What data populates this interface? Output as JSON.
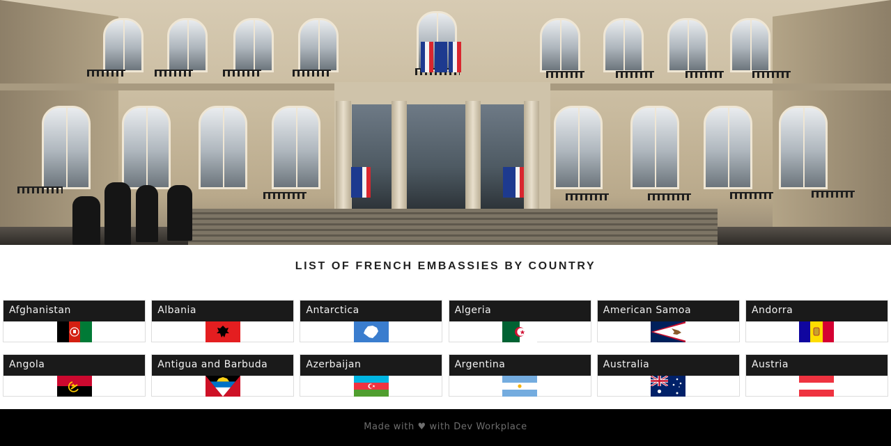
{
  "page": {
    "title": "LIST OF FRENCH EMBASSIES BY COUNTRY"
  },
  "hero": {
    "image_subject": "elysee-palace-facade-image"
  },
  "countries": [
    {
      "name": "Afghanistan",
      "flag_icon": "afghanistan-flag-icon"
    },
    {
      "name": "Albania",
      "flag_icon": "albania-flag-icon"
    },
    {
      "name": "Antarctica",
      "flag_icon": "antarctica-flag-icon"
    },
    {
      "name": "Algeria",
      "flag_icon": "algeria-flag-icon"
    },
    {
      "name": "American Samoa",
      "flag_icon": "american-samoa-flag-icon"
    },
    {
      "name": "Andorra",
      "flag_icon": "andorra-flag-icon"
    },
    {
      "name": "Angola",
      "flag_icon": "angola-flag-icon"
    },
    {
      "name": "Antigua and Barbuda",
      "flag_icon": "antigua-and-barbuda-flag-icon"
    },
    {
      "name": "Azerbaijan",
      "flag_icon": "azerbaijan-flag-icon"
    },
    {
      "name": "Argentina",
      "flag_icon": "argentina-flag-icon"
    },
    {
      "name": "Australia",
      "flag_icon": "australia-flag-icon"
    },
    {
      "name": "Austria",
      "flag_icon": "austria-flag-icon"
    }
  ],
  "footer": {
    "text": "Made with ♥ with Dev Workplace"
  },
  "colors": {
    "card_header_bg": "#1a1a1a",
    "card_header_text": "#f2f2f2",
    "footer_bg": "#000000",
    "footer_text": "#6e6e6e",
    "title_text": "#222222"
  }
}
